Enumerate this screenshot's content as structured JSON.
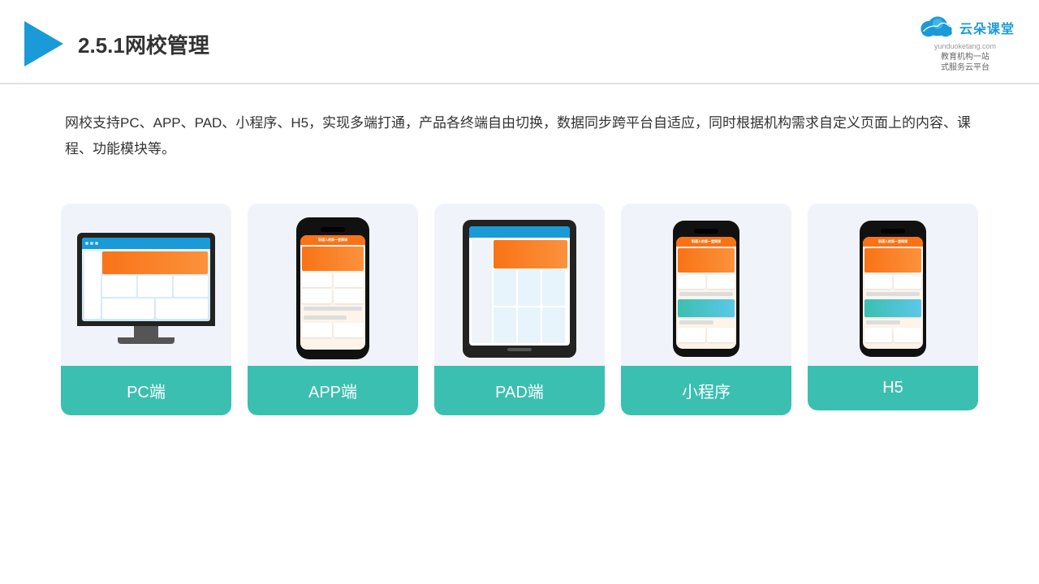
{
  "header": {
    "title": "2.5.1网校管理",
    "logo_text": "云朵课堂",
    "logo_url": "yunduoketang.com",
    "logo_subtitle_line1": "教育机构一站",
    "logo_subtitle_line2": "式服务云平台"
  },
  "description": {
    "text": "网校支持PC、APP、PAD、小程序、H5，实现多端打通，产品各终端自由切换，数据同步跨平台自适应，同时根据机构需求自定义页面上的内容、课程、功能模块等。"
  },
  "cards": [
    {
      "id": "pc",
      "label": "PC端"
    },
    {
      "id": "app",
      "label": "APP端"
    },
    {
      "id": "pad",
      "label": "PAD端"
    },
    {
      "id": "miniprogram",
      "label": "小程序"
    },
    {
      "id": "h5",
      "label": "H5"
    }
  ]
}
